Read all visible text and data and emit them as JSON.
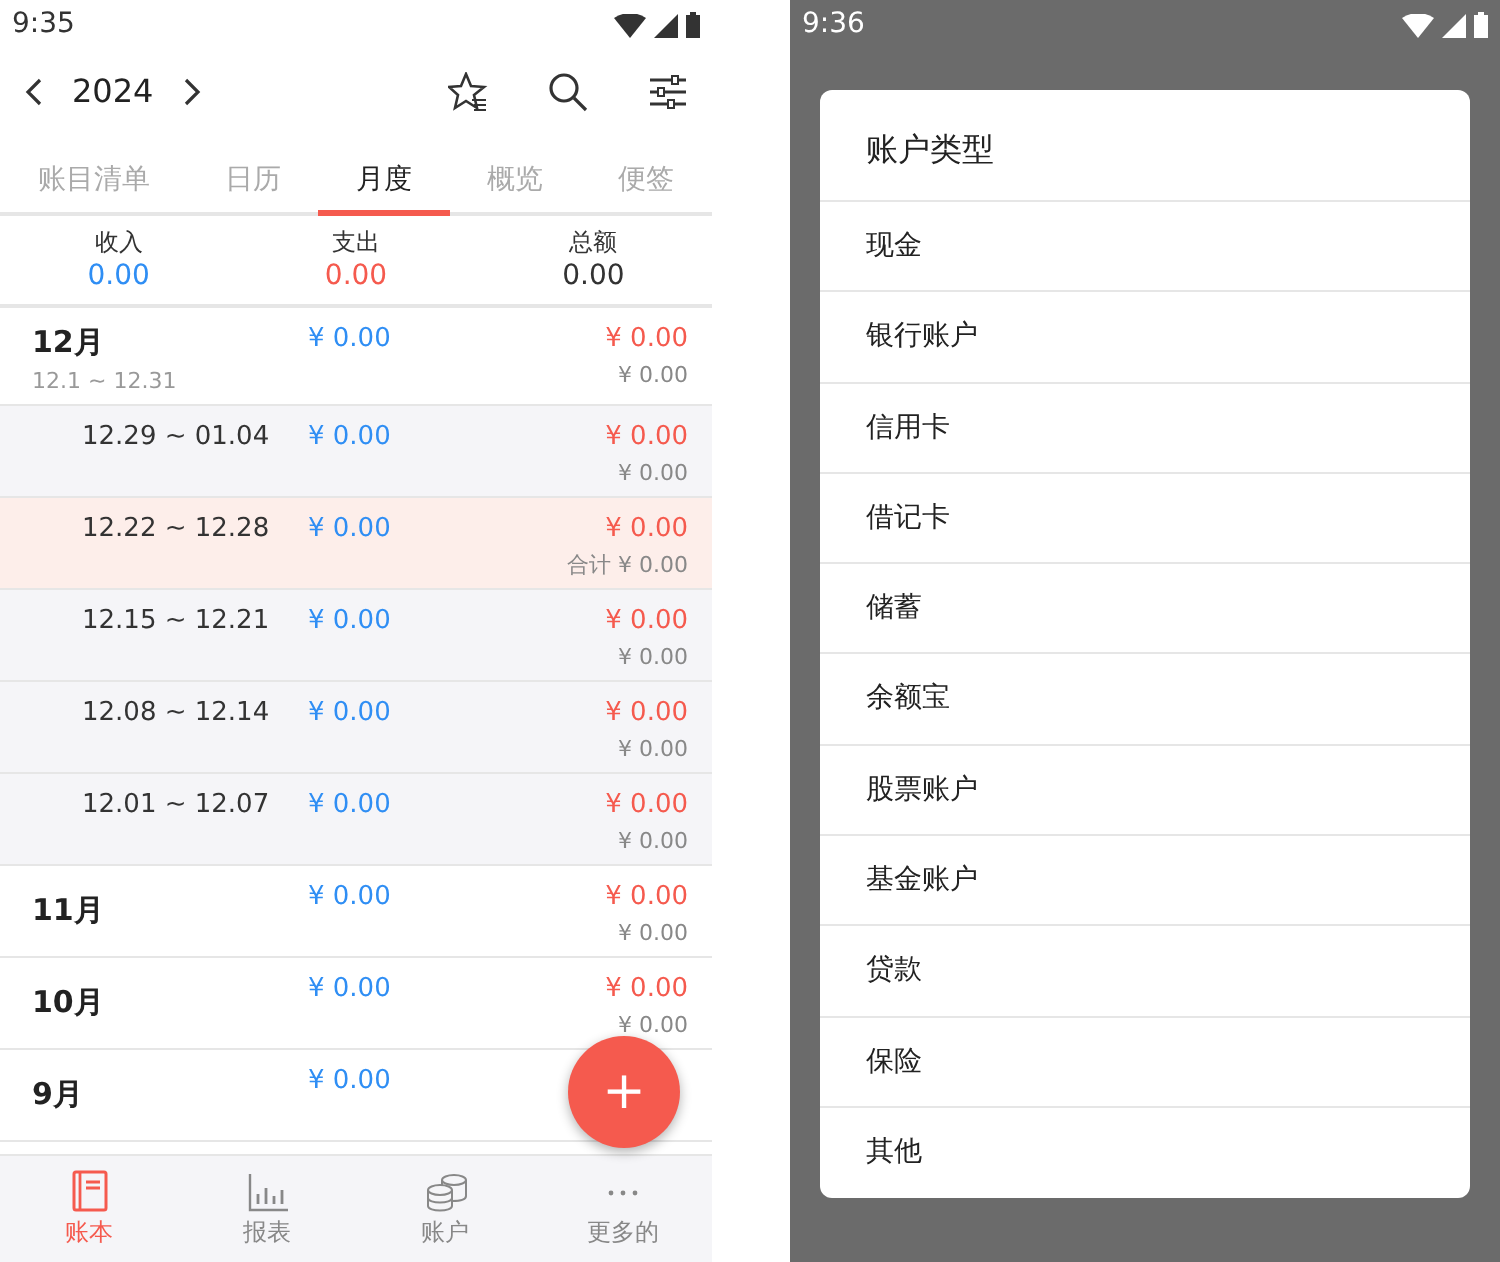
{
  "left_screen": {
    "status_bar": {
      "time": "9:35"
    },
    "toolbar": {
      "year": "2024"
    },
    "tabs": [
      {
        "label": "账目清单",
        "selected": false
      },
      {
        "label": "日历",
        "selected": false
      },
      {
        "label": "月度",
        "selected": true
      },
      {
        "label": "概览",
        "selected": false
      },
      {
        "label": "便签",
        "selected": false
      }
    ],
    "summary": [
      {
        "label": "收入",
        "value": "0.00",
        "kind": "income"
      },
      {
        "label": "支出",
        "value": "0.00",
        "kind": "expense"
      },
      {
        "label": "总额",
        "value": "0.00",
        "kind": "total"
      }
    ],
    "rows": [
      {
        "kind": "month",
        "label": "12月",
        "sub": "12.1 ~ 12.31",
        "income": "¥ 0.00",
        "expense": "¥ 0.00",
        "total": "¥ 0.00",
        "selected": false
      },
      {
        "kind": "week",
        "label": "12.29 ~ 01.04",
        "income": "¥ 0.00",
        "expense": "¥ 0.00",
        "total": "¥ 0.00",
        "selected": false
      },
      {
        "kind": "week",
        "label": "12.22 ~ 12.28",
        "income": "¥ 0.00",
        "expense": "¥ 0.00",
        "total": "合计 ¥ 0.00",
        "selected": true
      },
      {
        "kind": "week",
        "label": "12.15 ~ 12.21",
        "income": "¥ 0.00",
        "expense": "¥ 0.00",
        "total": "¥ 0.00",
        "selected": false
      },
      {
        "kind": "week",
        "label": "12.08 ~ 12.14",
        "income": "¥ 0.00",
        "expense": "¥ 0.00",
        "total": "¥ 0.00",
        "selected": false
      },
      {
        "kind": "week",
        "label": "12.01 ~ 12.07",
        "income": "¥ 0.00",
        "expense": "¥ 0.00",
        "total": "¥ 0.00",
        "selected": false
      },
      {
        "kind": "month",
        "label": "11月",
        "income": "¥ 0.00",
        "expense": "¥ 0.00",
        "total": "¥ 0.00",
        "selected": false
      },
      {
        "kind": "month",
        "label": "10月",
        "income": "¥ 0.00",
        "expense": "¥ 0.00",
        "total": "¥ 0.00",
        "selected": false
      },
      {
        "kind": "month",
        "label": "9月",
        "income": "¥ 0.00",
        "selected": false
      }
    ],
    "fab": {
      "label": "+"
    },
    "bottom_nav": [
      {
        "label": "账本",
        "kind": "book",
        "selected": true
      },
      {
        "label": "报表",
        "kind": "chart",
        "selected": false
      },
      {
        "label": "账户",
        "kind": "coins",
        "selected": false
      },
      {
        "label": "更多的",
        "kind": "more",
        "selected": false
      }
    ]
  },
  "right_screen": {
    "status_bar": {
      "time": "9:36"
    },
    "dialog": {
      "title": "账户类型",
      "items": [
        "现金",
        "银行账户",
        "信用卡",
        "借记卡",
        "储蓄",
        "余额宝",
        "股票账户",
        "基金账户",
        "贷款",
        "保险",
        "其他"
      ]
    }
  }
}
